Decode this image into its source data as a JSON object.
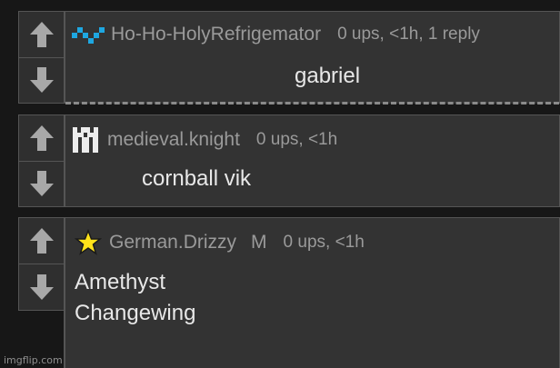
{
  "comments": [
    {
      "username": "Ho-Ho-HolyRefrigemator",
      "stats": "0 ups, <1h, 1 reply",
      "text": "gabriel",
      "icon": "blue-pixel-zigzag-icon"
    },
    {
      "username": "medieval.knight",
      "stats": "0 ups, <1h",
      "text": "cornball vik",
      "icon": "castle-icon"
    },
    {
      "username": "German.Drizzy",
      "flag": "M",
      "stats": "0 ups, <1h",
      "text_line1": "Amethyst",
      "text_line2": "Changewing",
      "icon": "yellow-star-icon"
    }
  ],
  "vote_icons": {
    "up": "arrow-up-icon",
    "down": "arrow-down-icon"
  },
  "colors": {
    "background": "#171717",
    "panel": "#333333",
    "username": "#9a9a9a",
    "text": "#e8e8e8",
    "accent_blue": "#1ea7e1",
    "star": "#ffe21a"
  },
  "watermark": "imgflip.com"
}
